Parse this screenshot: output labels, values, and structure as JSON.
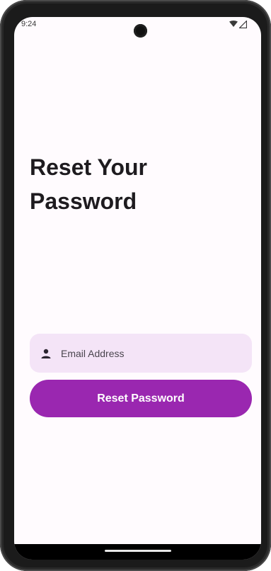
{
  "status_bar": {
    "time": "9:24",
    "icons": [
      "wifi-icon",
      "signal-icon"
    ]
  },
  "screen": {
    "title": "Reset Your Password",
    "email_field": {
      "icon": "person-icon",
      "placeholder": "Email Address",
      "value": ""
    },
    "reset_button_label": "Reset Password"
  },
  "colors": {
    "background": "#fffbfe",
    "field_background": "#f4e4f7",
    "button": "#9a27b0",
    "button_text": "#ffffff",
    "title_text": "#1e1b1f"
  }
}
